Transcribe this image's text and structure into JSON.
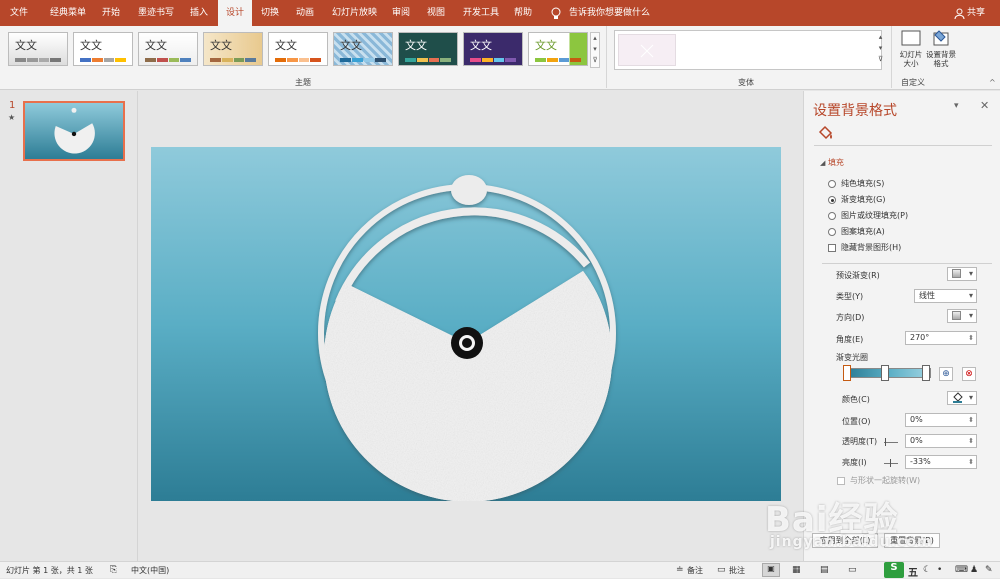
{
  "menubar": {
    "items": [
      "文件",
      "经典菜单",
      "开始",
      "墨迹书写",
      "插入",
      "设计",
      "切换",
      "动画",
      "幻灯片放映",
      "审阅",
      "视图",
      "开发工具",
      "帮助"
    ],
    "active_index": 5,
    "tell_me": "告诉我你想要做什么",
    "share": "共享"
  },
  "ribbon": {
    "themes_group_label": "主题",
    "variants_group_label": "变体",
    "custom_group_label": "自定义",
    "theme_sample_text": "文文",
    "slide_size_label": "幻灯片大小",
    "format_bg_label": "设置背景格式"
  },
  "thumbnails": {
    "slide_number": "1",
    "star": "★"
  },
  "pane": {
    "title": "设置背景格式",
    "fill_section": "填充",
    "options": [
      "纯色填充(S)",
      "渐变填充(G)",
      "图片或纹理填充(P)",
      "图案填充(A)"
    ],
    "selected_option": 1,
    "hide_bg_graphics": "隐藏背景图形(H)",
    "preset_gradient_label": "预设渐变(R)",
    "type_label": "类型(Y)",
    "type_value": "线性",
    "direction_label": "方向(D)",
    "angle_label": "角度(E)",
    "angle_value": "270°",
    "gradient_stops_label": "渐变光圈",
    "color_label": "颜色(C)",
    "position_label": "位置(O)",
    "position_value": "0%",
    "transparency_label": "透明度(T)",
    "transparency_value": "0%",
    "brightness_label": "亮度(I)",
    "brightness_value": "-33%",
    "rotate_with_shape": "与形状一起旋转(W)",
    "apply_all_button": "应用到全部(L)",
    "reset_button": "重置背景(B)"
  },
  "status": {
    "slide_info": "幻灯片 第 1 张，共 1 张",
    "language": "中文(中国)",
    "notes": "备注",
    "comments": "批注",
    "ime": "五"
  },
  "watermark": {
    "brand": "Bai经验",
    "url": "jingyan.baidu.com"
  },
  "colors": {
    "accent": "#b7472a",
    "pane_title": "#b7472a",
    "slide_bg_top": "#8fcadb",
    "slide_bg_bottom": "#2d7d95"
  }
}
